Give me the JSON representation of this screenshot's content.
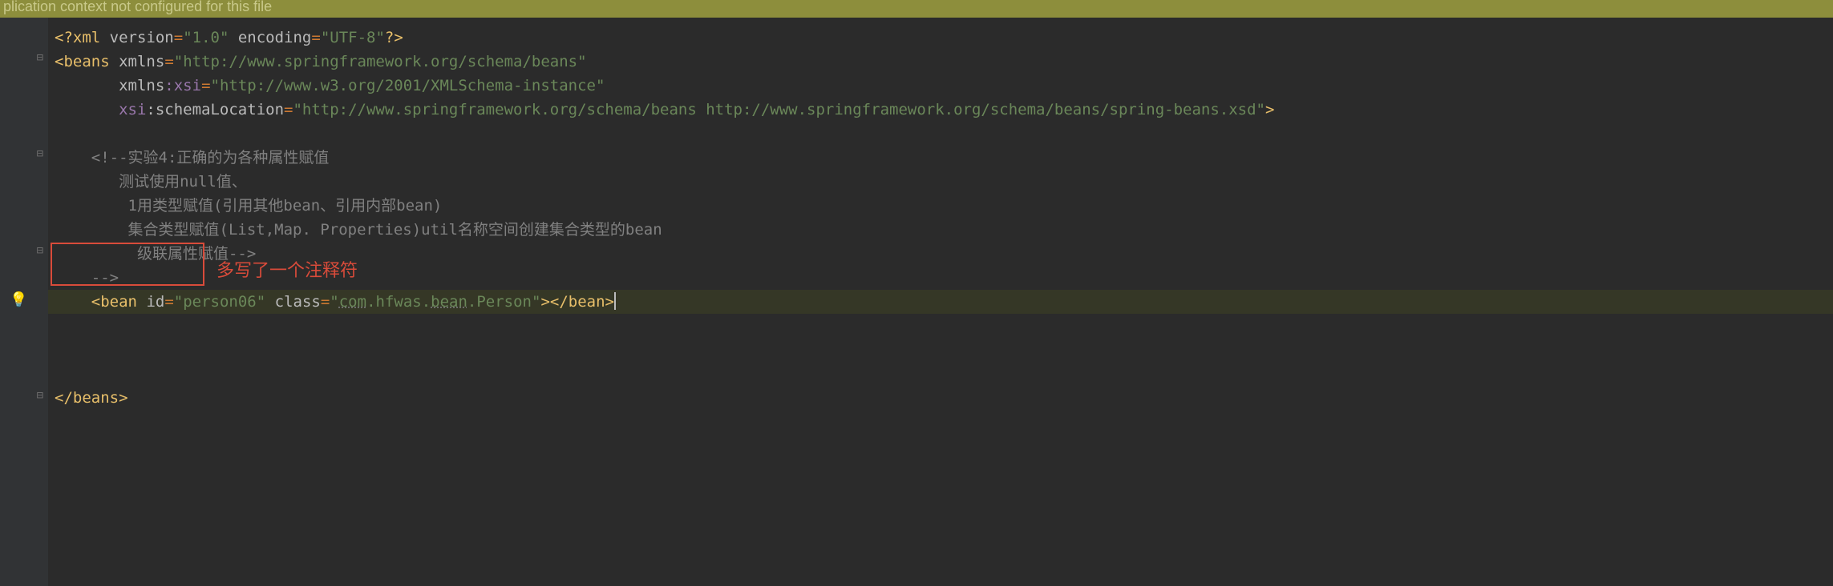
{
  "banner": {
    "text": "plication context not configured for this file"
  },
  "gutter": {
    "fold_icon_open": "⊟",
    "fold_icon_collapsed": "⊟",
    "bulb_icon": "💡"
  },
  "code": {
    "xml_decl": {
      "open": "<?",
      "tag": "xml",
      "sp": " ",
      "a_version": "version",
      "eq": "=",
      "v_version": "\"1.0\"",
      "sp2": " ",
      "a_encoding": "encoding",
      "v_encoding": "\"UTF-8\"",
      "close": "?>"
    },
    "beans_open": {
      "lt": "<",
      "tag": "beans",
      "sp": " ",
      "a_xmlns": "xmlns",
      "eq": "=",
      "v_xmlns": "\"http://www.springframework.org/schema/beans\"",
      "a_xmlns2": "xmlns",
      "colon": ":",
      "a_xsi": "xsi",
      "v_xsi": "\"http://www.w3.org/2001/XMLSchema-instance\"",
      "a_xsi2": "xsi",
      "colon2": ":",
      "a_schemaLoc": "schemaLocation",
      "v_schemaLoc": "\"http://www.springframework.org/schema/beans http://www.springframework.org/schema/beans/spring-beans.xsd\"",
      "gt": ">"
    },
    "c1": "<!--实验4:正确的为各种属性赋值",
    "c2": "测试使用null值、",
    "c3": " 1用类型赋值(引用其他bean、引用内部bean)",
    "c4": " 集合类型赋值(List,Map. Properties)util名称空间创建集合类型的bean",
    "c5": "  级联属性赋值-->",
    "c6": "-->",
    "bean": {
      "lt": "<",
      "tag": "bean",
      "sp": " ",
      "a_id": "id",
      "eq": "=",
      "v_id": "\"person06\"",
      "sp2": " ",
      "a_class": "class",
      "v_class_q": "\"",
      "v_class_p1": "com",
      "v_class_p2": ".hfwas.",
      "v_class_p3": "bean",
      "v_class_p4": ".Person",
      "v_class_q2": "\"",
      "gt": ">",
      "lt2": "</",
      "tag2": "bean",
      "gt2": ">"
    },
    "beans_close": {
      "lt": "</",
      "tag": "beans",
      "gt": ">"
    }
  },
  "annotation": {
    "text": "多写了一个注释符"
  }
}
